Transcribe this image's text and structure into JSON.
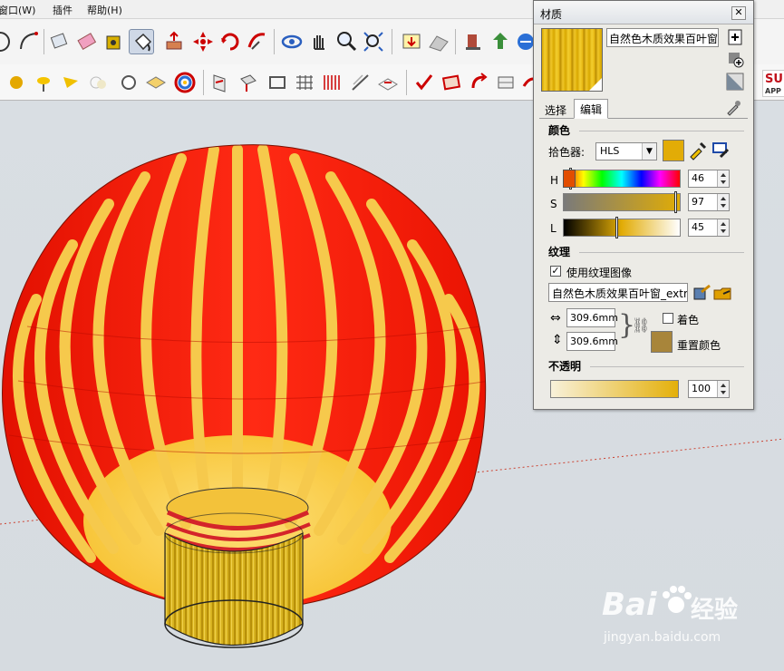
{
  "menu": {
    "window": "窗口(W)",
    "plugins": "插件",
    "help": "帮助(H)"
  },
  "toolbar1": {
    "items": [
      "orbit-icon",
      "arc-icon",
      "eraser-icon",
      "tape-measure-icon",
      "paint-bucket-icon",
      "push-pull-icon",
      "move-icon",
      "rotate-icon",
      "follow-me-icon",
      "orbit-view-icon",
      "pan-icon",
      "zoom-icon",
      "zoom-extents-icon",
      "add-location-icon",
      "toggle-terrain-icon",
      "get-models-icon",
      "share-model-icon",
      "components-icon",
      "warehouse-icon"
    ]
  },
  "toolbar2": {
    "items": [
      "sphere-icon",
      "tape-icon",
      "cone-icon",
      "fog-icon",
      "circle-icon",
      "section-plane-icon",
      "color-wheel-icon",
      "camera-icon",
      "push-icon",
      "frame-icon",
      "grid-icon",
      "stairs-icon",
      "ramp-icon",
      "plane-icon",
      "check-icon",
      "card-icon",
      "flip-icon",
      "layout-icon",
      "arc-tool-icon",
      "globe-icon"
    ],
    "brand_fragment": "SU",
    "brand_sub": "APP"
  },
  "dialog": {
    "title": "材质",
    "material_name": "自然色木质效果百叶窗",
    "tabs": [
      "选择",
      "编辑"
    ],
    "active_tab": "编辑",
    "color_section": "颜色",
    "picker_label": "拾色器:",
    "picker_value": "HLS",
    "swatch_color": "#e2ac06",
    "hls": {
      "h_label": "H",
      "h_value": "46",
      "h_level": 0.05,
      "s_label": "S",
      "s_value": "97",
      "s_level": 0.97,
      "l_label": "L",
      "l_value": "45",
      "l_level": 0.45
    },
    "texture_section": "纹理",
    "use_texture_label": "使用纹理图像",
    "use_texture_checked": true,
    "texture_file": "自然色木质效果百叶窗_extra",
    "width_value": "309.6mm",
    "height_value": "309.6mm",
    "colorize_label": "着色",
    "colorize_checked": false,
    "reset_color_label": "重置颜色",
    "reset_swatch": "#a8853a",
    "opacity_section": "不透明",
    "opacity_value": "100"
  },
  "watermark": {
    "brand": "Bai",
    "brand_cn": "经验",
    "url": "jingyan.baidu.com"
  }
}
